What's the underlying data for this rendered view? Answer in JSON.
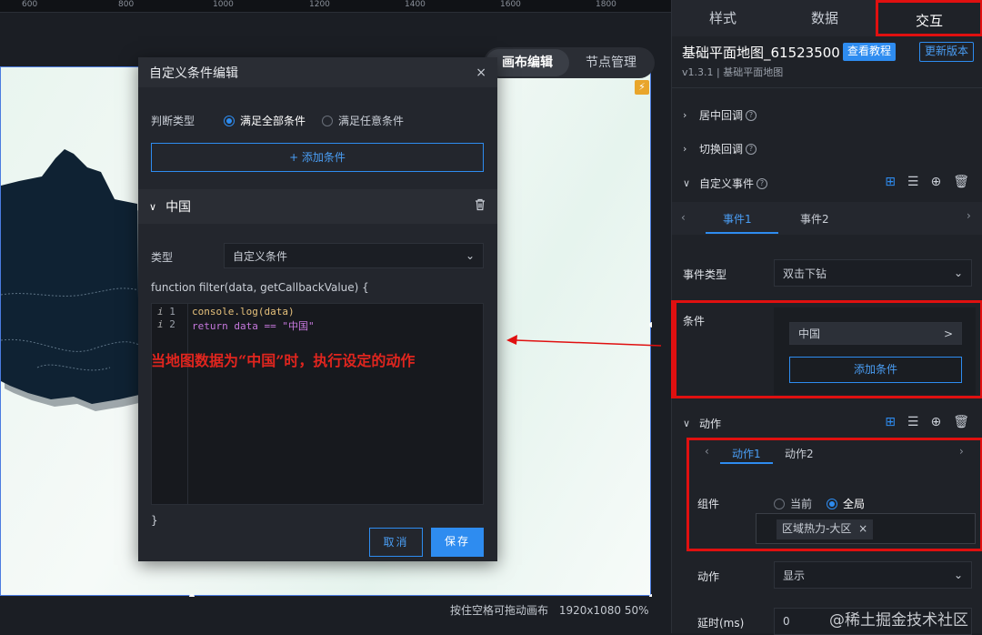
{
  "ruler": {
    "ticks": [
      "600",
      "800",
      "1000",
      "1200",
      "1400",
      "1600",
      "1800"
    ]
  },
  "mode_tabs": {
    "canvas_edit": "画布编辑",
    "node_manage": "节点管理"
  },
  "status_bar": {
    "hint": "按住空格可拖动画布",
    "resolution": "1920x1080 50%"
  },
  "dialog": {
    "title": "自定义条件编辑",
    "close": "×",
    "judge_type_label": "判断类型",
    "option_all": "满足全部条件",
    "option_any": "满足任意条件",
    "add_condition": "+ 添加条件",
    "condition_name": "中国",
    "type_label": "类型",
    "type_value": "自定义条件",
    "function_signature": "function filter(data, getCallbackValue) {",
    "code_lines": [
      {
        "num": "1",
        "code": "console.log(data)"
      },
      {
        "num": "2",
        "code": "return data == \"中国\""
      }
    ],
    "closing_brace": "}",
    "cancel": "取消",
    "save": "保存"
  },
  "annotation": "当地图数据为“中国”时，执行设定的动作",
  "panel": {
    "tabs": [
      "样式",
      "数据",
      "交互"
    ],
    "title": "基础平面地图_61523500",
    "view_tutorial": "查看教程",
    "update_version": "更新版本",
    "subtitle": "v1.3.1 | 基础平面地图",
    "sections": {
      "center_callback": "居中回调",
      "switch_callback": "切换回调",
      "custom_event": "自定义事件",
      "action": "动作"
    },
    "event_tabs": [
      "事件1",
      "事件2"
    ],
    "event_type_label": "事件类型",
    "event_type_value": "双击下钻",
    "condition_label": "条件",
    "condition_item": "中国",
    "condition_item_arrow": ">",
    "add_condition": "添加条件",
    "action_tabs": [
      "动作1",
      "动作2"
    ],
    "component_label": "组件",
    "scope_current": "当前",
    "scope_global": "全局",
    "component_tag": "区域热力-大区",
    "action_label": "动作",
    "action_value": "显示",
    "delay_label": "延时(ms)",
    "delay_value": "0"
  },
  "watermark": "@稀土掘金技术社区",
  "colors": {
    "accent": "#2e8cf0",
    "highlight": "#e01010",
    "annotation": "#e0251e",
    "map_fill": "#0f2233"
  }
}
